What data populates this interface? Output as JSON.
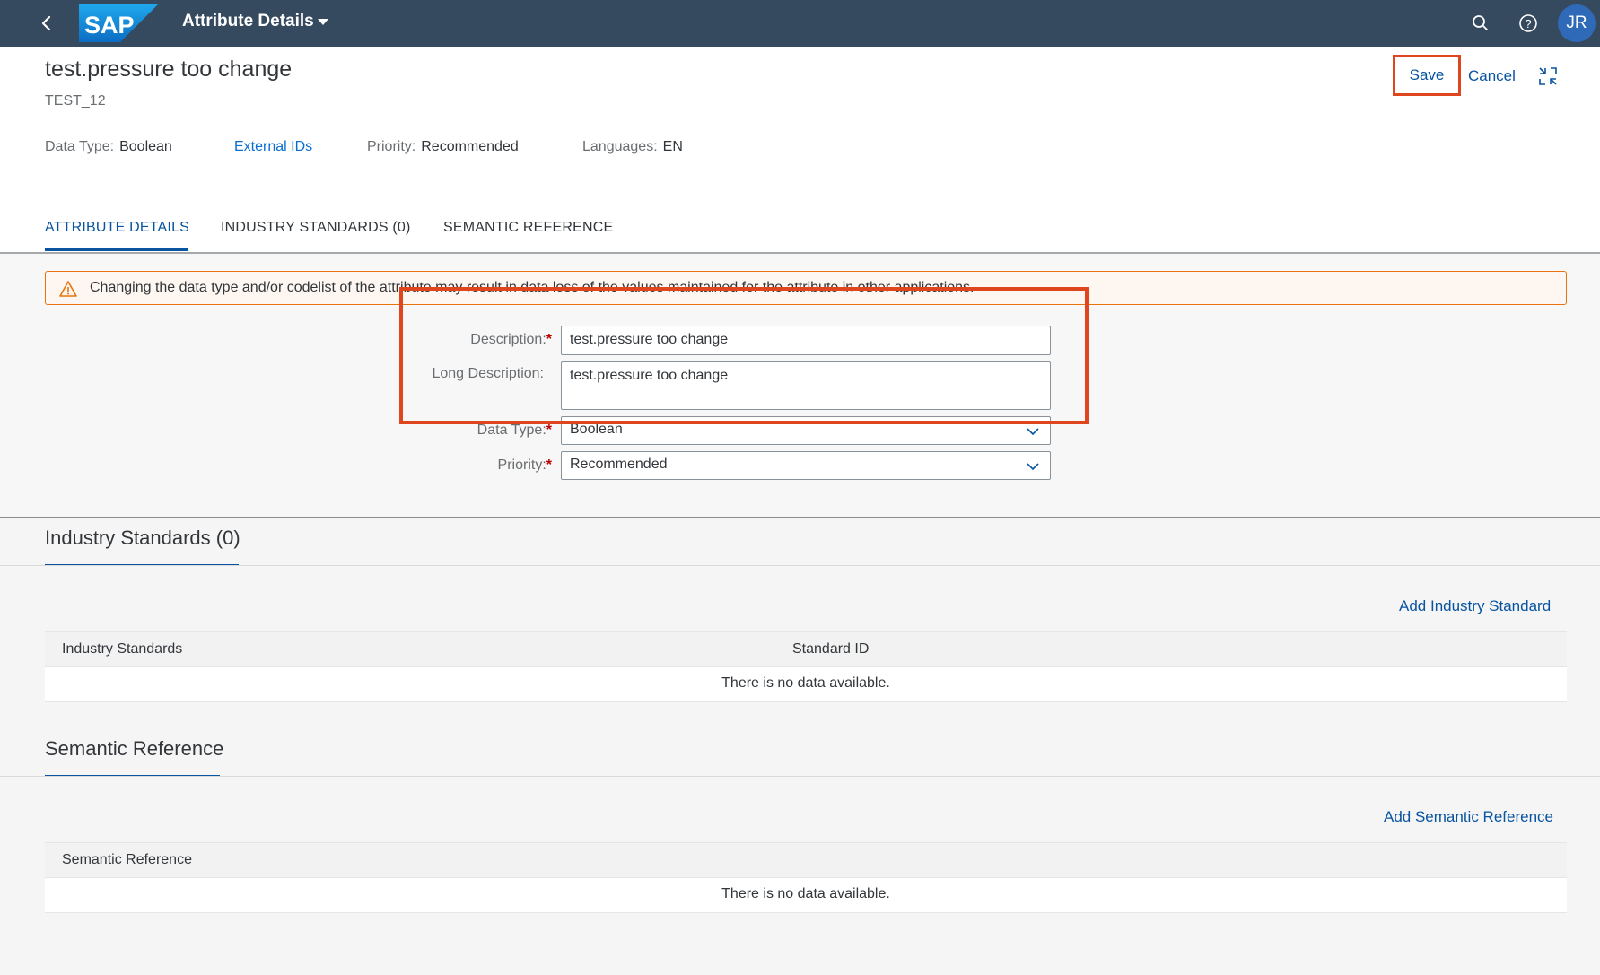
{
  "shell": {
    "logo_text": "SAP",
    "app_title": "Attribute Details",
    "avatar_initials": "JR",
    "icons": [
      "back-icon",
      "search-icon",
      "help-icon"
    ]
  },
  "header": {
    "title": "test.pressure too change",
    "subtitle": "TEST_12",
    "data_type_label": "Data Type:",
    "data_type_value": "Boolean",
    "external_ids_link": "External IDs",
    "priority_label": "Priority:",
    "priority_value": "Recommended",
    "languages_label": "Languages:",
    "languages_value": "EN",
    "save_label": "Save",
    "cancel_label": "Cancel"
  },
  "tabs": [
    {
      "label": "ATTRIBUTE DETAILS",
      "active": true
    },
    {
      "label": "INDUSTRY STANDARDS (0)",
      "active": false
    },
    {
      "label": "SEMANTIC REFERENCE",
      "active": false
    }
  ],
  "warning": {
    "message": "Changing the data type and/or codelist of the attribute may result in data loss of the values maintained for the attribute in other applications."
  },
  "form": {
    "description_label": "Description:",
    "description_value": "test.pressure too change",
    "long_description_label": "Long Description:",
    "long_description_value": "test.pressure too change",
    "data_type_label": "Data Type:",
    "data_type_value": "Boolean",
    "priority_label": "Priority:",
    "priority_value": "Recommended",
    "required_marker": "*"
  },
  "industry_section": {
    "title": "Industry Standards (0)",
    "add_link": "Add Industry Standard",
    "columns": [
      "Industry Standards",
      "Standard ID"
    ],
    "empty_text": "There is no data available."
  },
  "semantic_section": {
    "title": "Semantic Reference",
    "add_link": "Add Semantic Reference",
    "columns": [
      "Semantic Reference"
    ],
    "empty_text": "There is no data available."
  },
  "colors": {
    "shell_bg": "#354a5f",
    "accent": "#0854a0",
    "highlight_box": "#e0461e",
    "warning": "#e9730c",
    "required": "#bb0000"
  }
}
